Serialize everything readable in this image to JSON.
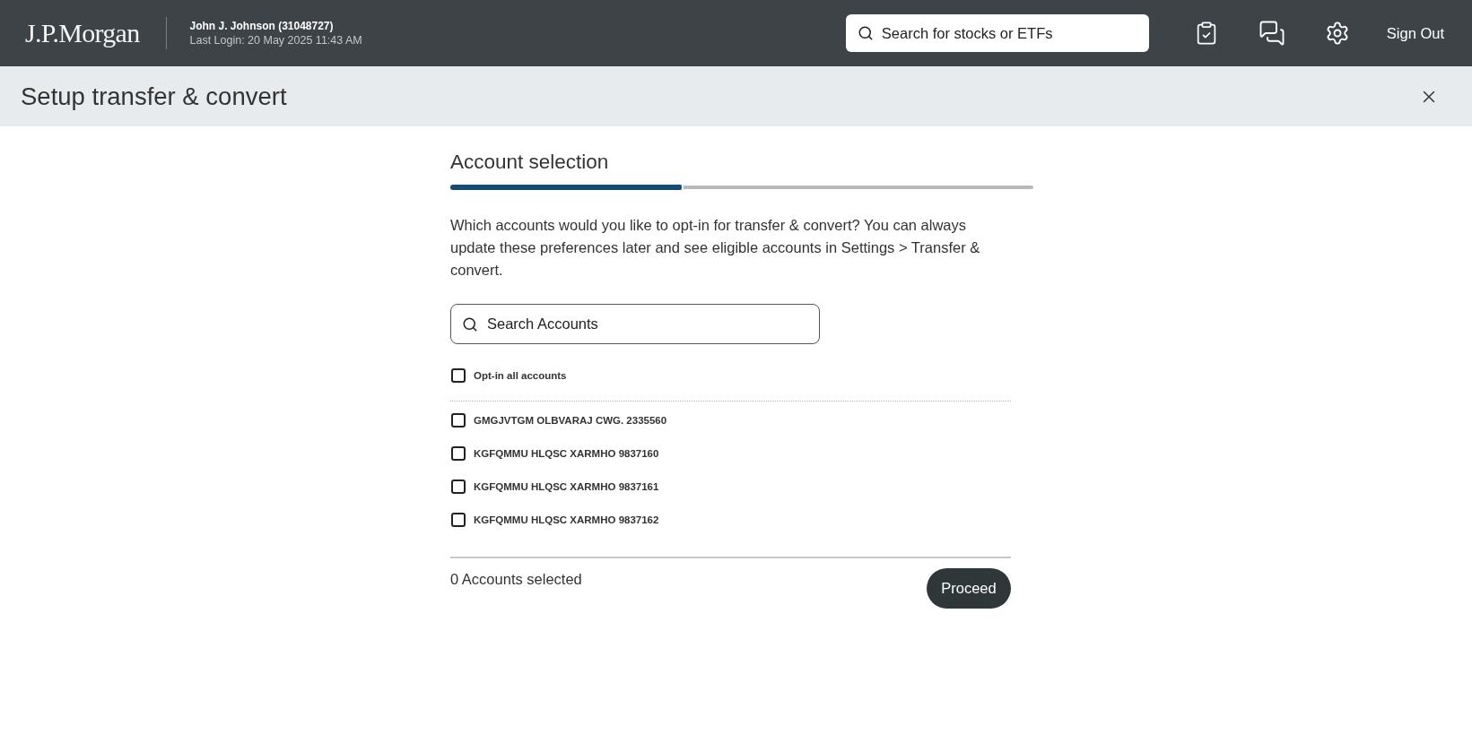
{
  "header": {
    "logo": "J.P.Morgan",
    "user_name": "John J. Johnson (31048727)",
    "last_login": "Last Login: 20 May 2025 11:43 AM",
    "search": {
      "placeholder": "Search for stocks or ETFs"
    },
    "sign_out": "Sign Out"
  },
  "page_bar": {
    "title": "Setup transfer & convert"
  },
  "step": {
    "title": "Account selection",
    "progress": {
      "level": 0.4
    }
  },
  "intro": "Which accounts would you like to opt-in for transfer & convert? You can always update these preferences later and see eligible accounts in Settings > Transfer & convert.",
  "account_search": {
    "placeholder": "Search Accounts"
  },
  "select_all": {
    "label": "Opt-in all accounts",
    "checked": false
  },
  "accounts": [
    {
      "label": "GMGJVTGM OLBVARAJ CWG. 2335560",
      "checked": false
    },
    {
      "label": "KGFQMMU HLQSC XARMHO 9837160",
      "checked": false
    },
    {
      "label": "KGFQMMU HLQSC XARMHO 9837161",
      "checked": false
    },
    {
      "label": "KGFQMMU HLQSC XARMHO 9837162",
      "checked": false
    }
  ],
  "footer": {
    "selected_count": "0 Accounts selected",
    "proceed_button": "Proceed"
  }
}
